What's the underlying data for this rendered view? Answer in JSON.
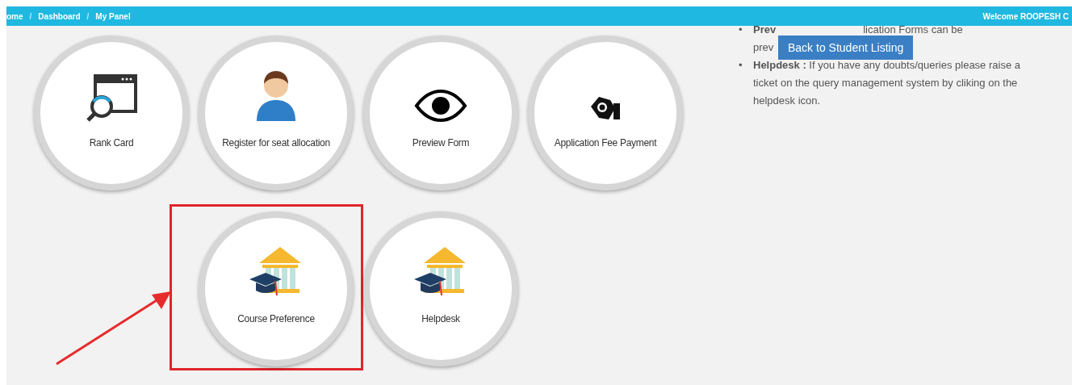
{
  "breadcrumb": [
    "ome",
    "Dashboard",
    "My Panel"
  ],
  "breadcrumb_separator": "/",
  "welcome": "Welcome ROOPESH C",
  "tiles": [
    {
      "label": "Rank Card",
      "highlighted": false
    },
    {
      "label": "Register for seat allocation",
      "highlighted": false
    },
    {
      "label": "Preview Form",
      "highlighted": false
    },
    {
      "label": "Application Fee Payment",
      "highlighted": false
    },
    {
      "label": "Course Preference",
      "highlighted": true
    },
    {
      "label": "Helpdesk",
      "highlighted": false
    }
  ],
  "info": {
    "bullet": "•",
    "preview_lead": "Prev",
    "preview_tail": "lication Forms can be",
    "preview_line2": "prev",
    "helpdesk": "**Helpdesk :** If you have any doubts/queries please raise a ticket on the query management system by cliking on the helpdesk icon."
  },
  "back_button": "Back to Student Listing"
}
